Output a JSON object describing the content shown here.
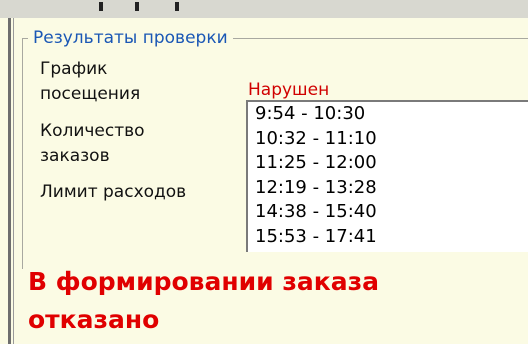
{
  "group": {
    "title": "Результаты проверки"
  },
  "checks": {
    "schedule_label_line1": "График",
    "schedule_label_line2": "посещения",
    "orders_label_line1": "Количество",
    "orders_label_line2": "заказов",
    "limit_label": "Лимит расходов",
    "schedule_status": "Нарушен"
  },
  "visits": [
    "9:54 - 10:30",
    "10:32 - 11:10",
    "11:25 - 12:00",
    "12:19 - 13:28",
    "14:38 - 15:40",
    "15:53 - 17:41"
  ],
  "result": {
    "message_line1": "В формировании заказа",
    "message_line2": "отказано"
  },
  "colors": {
    "background": "#fbfbe4",
    "legend_text": "#1a57b5",
    "status_red": "#d00000",
    "message_red": "#e00000"
  }
}
